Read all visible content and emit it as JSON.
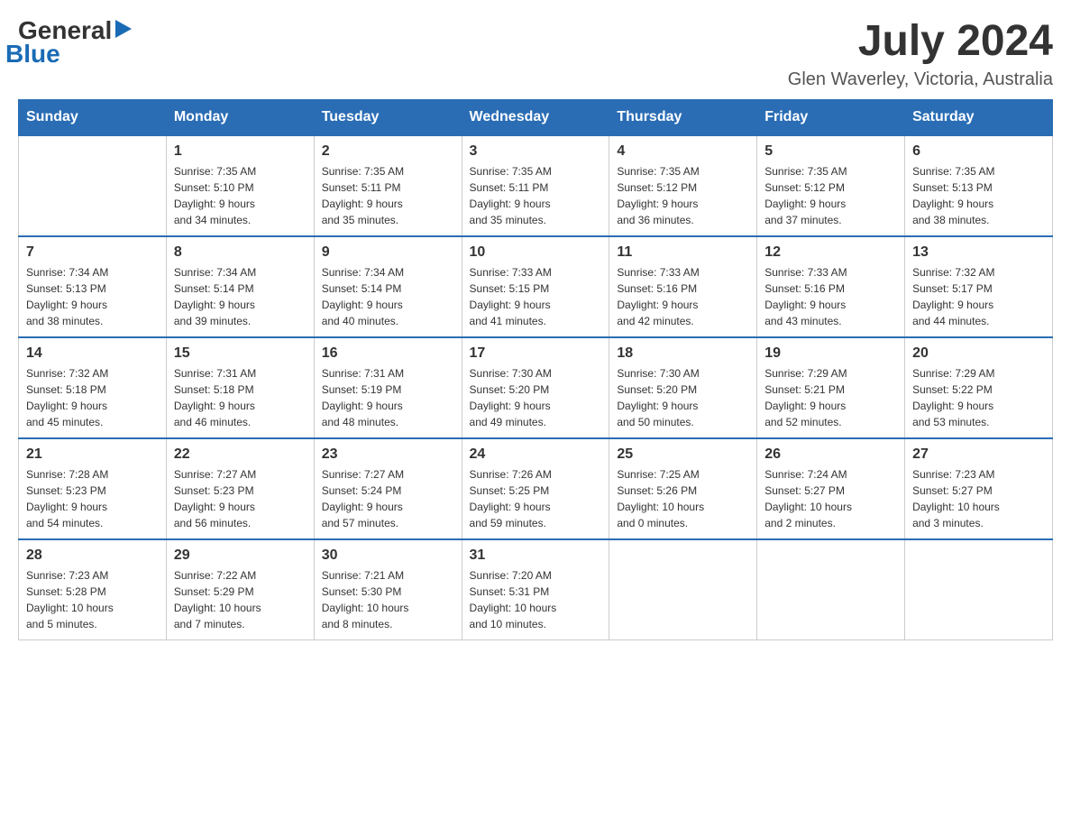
{
  "logo": {
    "general": "General",
    "blue": "Blue"
  },
  "title": {
    "month_year": "July 2024",
    "location": "Glen Waverley, Victoria, Australia"
  },
  "days_of_week": [
    "Sunday",
    "Monday",
    "Tuesday",
    "Wednesday",
    "Thursday",
    "Friday",
    "Saturday"
  ],
  "weeks": [
    [
      {
        "day": "",
        "info": ""
      },
      {
        "day": "1",
        "info": "Sunrise: 7:35 AM\nSunset: 5:10 PM\nDaylight: 9 hours\nand 34 minutes."
      },
      {
        "day": "2",
        "info": "Sunrise: 7:35 AM\nSunset: 5:11 PM\nDaylight: 9 hours\nand 35 minutes."
      },
      {
        "day": "3",
        "info": "Sunrise: 7:35 AM\nSunset: 5:11 PM\nDaylight: 9 hours\nand 35 minutes."
      },
      {
        "day": "4",
        "info": "Sunrise: 7:35 AM\nSunset: 5:12 PM\nDaylight: 9 hours\nand 36 minutes."
      },
      {
        "day": "5",
        "info": "Sunrise: 7:35 AM\nSunset: 5:12 PM\nDaylight: 9 hours\nand 37 minutes."
      },
      {
        "day": "6",
        "info": "Sunrise: 7:35 AM\nSunset: 5:13 PM\nDaylight: 9 hours\nand 38 minutes."
      }
    ],
    [
      {
        "day": "7",
        "info": "Sunrise: 7:34 AM\nSunset: 5:13 PM\nDaylight: 9 hours\nand 38 minutes."
      },
      {
        "day": "8",
        "info": "Sunrise: 7:34 AM\nSunset: 5:14 PM\nDaylight: 9 hours\nand 39 minutes."
      },
      {
        "day": "9",
        "info": "Sunrise: 7:34 AM\nSunset: 5:14 PM\nDaylight: 9 hours\nand 40 minutes."
      },
      {
        "day": "10",
        "info": "Sunrise: 7:33 AM\nSunset: 5:15 PM\nDaylight: 9 hours\nand 41 minutes."
      },
      {
        "day": "11",
        "info": "Sunrise: 7:33 AM\nSunset: 5:16 PM\nDaylight: 9 hours\nand 42 minutes."
      },
      {
        "day": "12",
        "info": "Sunrise: 7:33 AM\nSunset: 5:16 PM\nDaylight: 9 hours\nand 43 minutes."
      },
      {
        "day": "13",
        "info": "Sunrise: 7:32 AM\nSunset: 5:17 PM\nDaylight: 9 hours\nand 44 minutes."
      }
    ],
    [
      {
        "day": "14",
        "info": "Sunrise: 7:32 AM\nSunset: 5:18 PM\nDaylight: 9 hours\nand 45 minutes."
      },
      {
        "day": "15",
        "info": "Sunrise: 7:31 AM\nSunset: 5:18 PM\nDaylight: 9 hours\nand 46 minutes."
      },
      {
        "day": "16",
        "info": "Sunrise: 7:31 AM\nSunset: 5:19 PM\nDaylight: 9 hours\nand 48 minutes."
      },
      {
        "day": "17",
        "info": "Sunrise: 7:30 AM\nSunset: 5:20 PM\nDaylight: 9 hours\nand 49 minutes."
      },
      {
        "day": "18",
        "info": "Sunrise: 7:30 AM\nSunset: 5:20 PM\nDaylight: 9 hours\nand 50 minutes."
      },
      {
        "day": "19",
        "info": "Sunrise: 7:29 AM\nSunset: 5:21 PM\nDaylight: 9 hours\nand 52 minutes."
      },
      {
        "day": "20",
        "info": "Sunrise: 7:29 AM\nSunset: 5:22 PM\nDaylight: 9 hours\nand 53 minutes."
      }
    ],
    [
      {
        "day": "21",
        "info": "Sunrise: 7:28 AM\nSunset: 5:23 PM\nDaylight: 9 hours\nand 54 minutes."
      },
      {
        "day": "22",
        "info": "Sunrise: 7:27 AM\nSunset: 5:23 PM\nDaylight: 9 hours\nand 56 minutes."
      },
      {
        "day": "23",
        "info": "Sunrise: 7:27 AM\nSunset: 5:24 PM\nDaylight: 9 hours\nand 57 minutes."
      },
      {
        "day": "24",
        "info": "Sunrise: 7:26 AM\nSunset: 5:25 PM\nDaylight: 9 hours\nand 59 minutes."
      },
      {
        "day": "25",
        "info": "Sunrise: 7:25 AM\nSunset: 5:26 PM\nDaylight: 10 hours\nand 0 minutes."
      },
      {
        "day": "26",
        "info": "Sunrise: 7:24 AM\nSunset: 5:27 PM\nDaylight: 10 hours\nand 2 minutes."
      },
      {
        "day": "27",
        "info": "Sunrise: 7:23 AM\nSunset: 5:27 PM\nDaylight: 10 hours\nand 3 minutes."
      }
    ],
    [
      {
        "day": "28",
        "info": "Sunrise: 7:23 AM\nSunset: 5:28 PM\nDaylight: 10 hours\nand 5 minutes."
      },
      {
        "day": "29",
        "info": "Sunrise: 7:22 AM\nSunset: 5:29 PM\nDaylight: 10 hours\nand 7 minutes."
      },
      {
        "day": "30",
        "info": "Sunrise: 7:21 AM\nSunset: 5:30 PM\nDaylight: 10 hours\nand 8 minutes."
      },
      {
        "day": "31",
        "info": "Sunrise: 7:20 AM\nSunset: 5:31 PM\nDaylight: 10 hours\nand 10 minutes."
      },
      {
        "day": "",
        "info": ""
      },
      {
        "day": "",
        "info": ""
      },
      {
        "day": "",
        "info": ""
      }
    ]
  ]
}
